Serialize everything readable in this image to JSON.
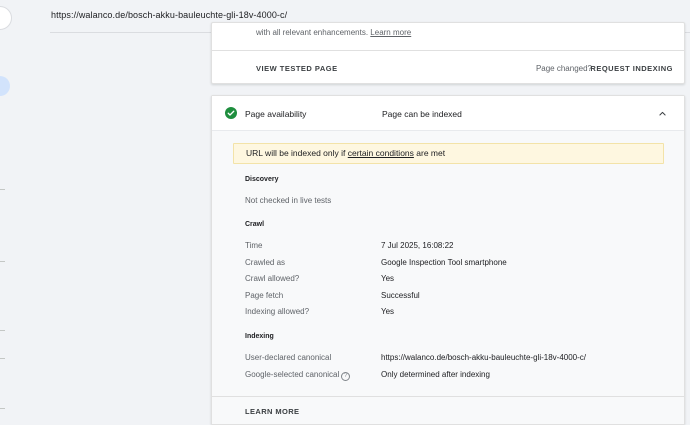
{
  "url_bar": {
    "url": "https://walanco.de/bosch-akku-bauleuchte-gli-18v-4000-c/"
  },
  "top_card": {
    "enhancement_text": "with all relevant enhancements.",
    "enhancement_link": "Learn more",
    "view_tested_page": "VIEW TESTED PAGE",
    "page_changed": "Page changed?",
    "request_indexing": "REQUEST INDEXING"
  },
  "availability_card": {
    "title": "Page availability",
    "status": "Page can be indexed",
    "status_color": "#1e8e3e",
    "icons": {
      "status": "check-circle-icon",
      "collapse": "chevron-up-icon",
      "help": "help-icon"
    },
    "notice": {
      "prefix": "URL will be indexed only if",
      "link": "certain conditions",
      "suffix": "are met"
    },
    "discovery": {
      "title": "Discovery",
      "text": "Not checked in live tests"
    },
    "crawl": {
      "title": "Crawl",
      "rows": [
        {
          "label": "Time",
          "value": "7 Jul 2025, 16:08:22"
        },
        {
          "label": "Crawled as",
          "value": "Google Inspection Tool smartphone"
        },
        {
          "label": "Crawl allowed?",
          "value": "Yes"
        },
        {
          "label": "Page fetch",
          "value": "Successful"
        },
        {
          "label": "Indexing allowed?",
          "value": "Yes"
        }
      ]
    },
    "indexing": {
      "title": "Indexing",
      "rows": [
        {
          "label": "User-declared canonical",
          "value": "https://walanco.de/bosch-akku-bauleuchte-gli-18v-4000-c/"
        },
        {
          "label": "Google-selected canonical",
          "value": "Only determined after indexing"
        }
      ]
    },
    "learn_more": "LEARN MORE"
  }
}
